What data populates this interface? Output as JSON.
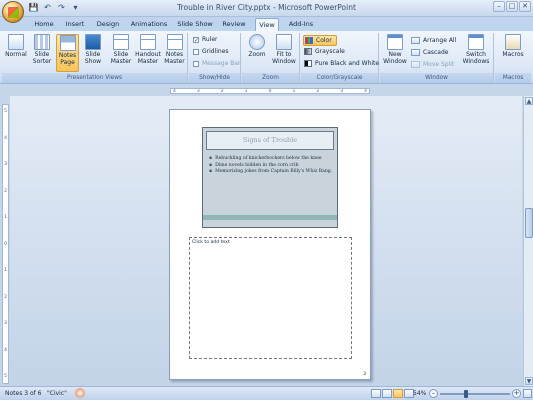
{
  "window": {
    "title": "Trouble in River City.pptx - Microsoft PowerPoint"
  },
  "qat": {
    "save": "💾",
    "undo": "↶",
    "redo": "↷",
    "more": "▾"
  },
  "winctl": {
    "min": "–",
    "max": "□",
    "close": "✕"
  },
  "tabs": [
    "Home",
    "Insert",
    "Design",
    "Animations",
    "Slide Show",
    "Review",
    "View",
    "Add-Ins"
  ],
  "ribbon": {
    "presentation_views": {
      "label": "Presentation Views",
      "buttons": [
        "Normal",
        "Slide Sorter",
        "Notes Page",
        "Slide Show",
        "Slide Master",
        "Handout Master",
        "Notes Master"
      ]
    },
    "show_hide": {
      "label": "Show/Hide",
      "ruler": "Ruler",
      "gridlines": "Gridlines",
      "message_bar": "Message Bar",
      "check": "✓"
    },
    "zoom": {
      "label": "Zoom",
      "zoom": "Zoom",
      "fit": "Fit to Window"
    },
    "color": {
      "label": "Color/Grayscale",
      "color": "Color",
      "grayscale": "Grayscale",
      "bw": "Pure Black and White"
    },
    "window": {
      "label": "Window",
      "new": "New Window",
      "arrange": "Arrange All",
      "cascade": "Cascade",
      "move_split": "Move Split",
      "switch": "Switch Windows"
    },
    "macros": {
      "label": "Macros",
      "macros": "Macros"
    }
  },
  "ruler_h": [
    "4",
    "3",
    "2",
    "1",
    "0",
    "1",
    "2",
    "3",
    "4"
  ],
  "ruler_v": [
    "5",
    "4",
    "3",
    "2",
    "1",
    "0",
    "1",
    "2",
    "3",
    "4",
    "5"
  ],
  "slide": {
    "title": "Signs of Trouble",
    "bullets": [
      "Rebuckling of knickerbockers below the knee",
      "Dime novels hidden in the corn crib",
      "Memorizing jokes from Captain Billy's Whiz Bang."
    ]
  },
  "notes": {
    "placeholder": "Click to add text",
    "page_number": "3"
  },
  "status": {
    "notes": "Notes 3 of 6",
    "theme": "\"Civic\"",
    "zoom": "54%",
    "zoom_minus": "–",
    "zoom_plus": "+"
  },
  "colors": {
    "accent": "#f9c45b",
    "ribbon": "#dde8f6",
    "workspace": "#c3d3e8"
  }
}
